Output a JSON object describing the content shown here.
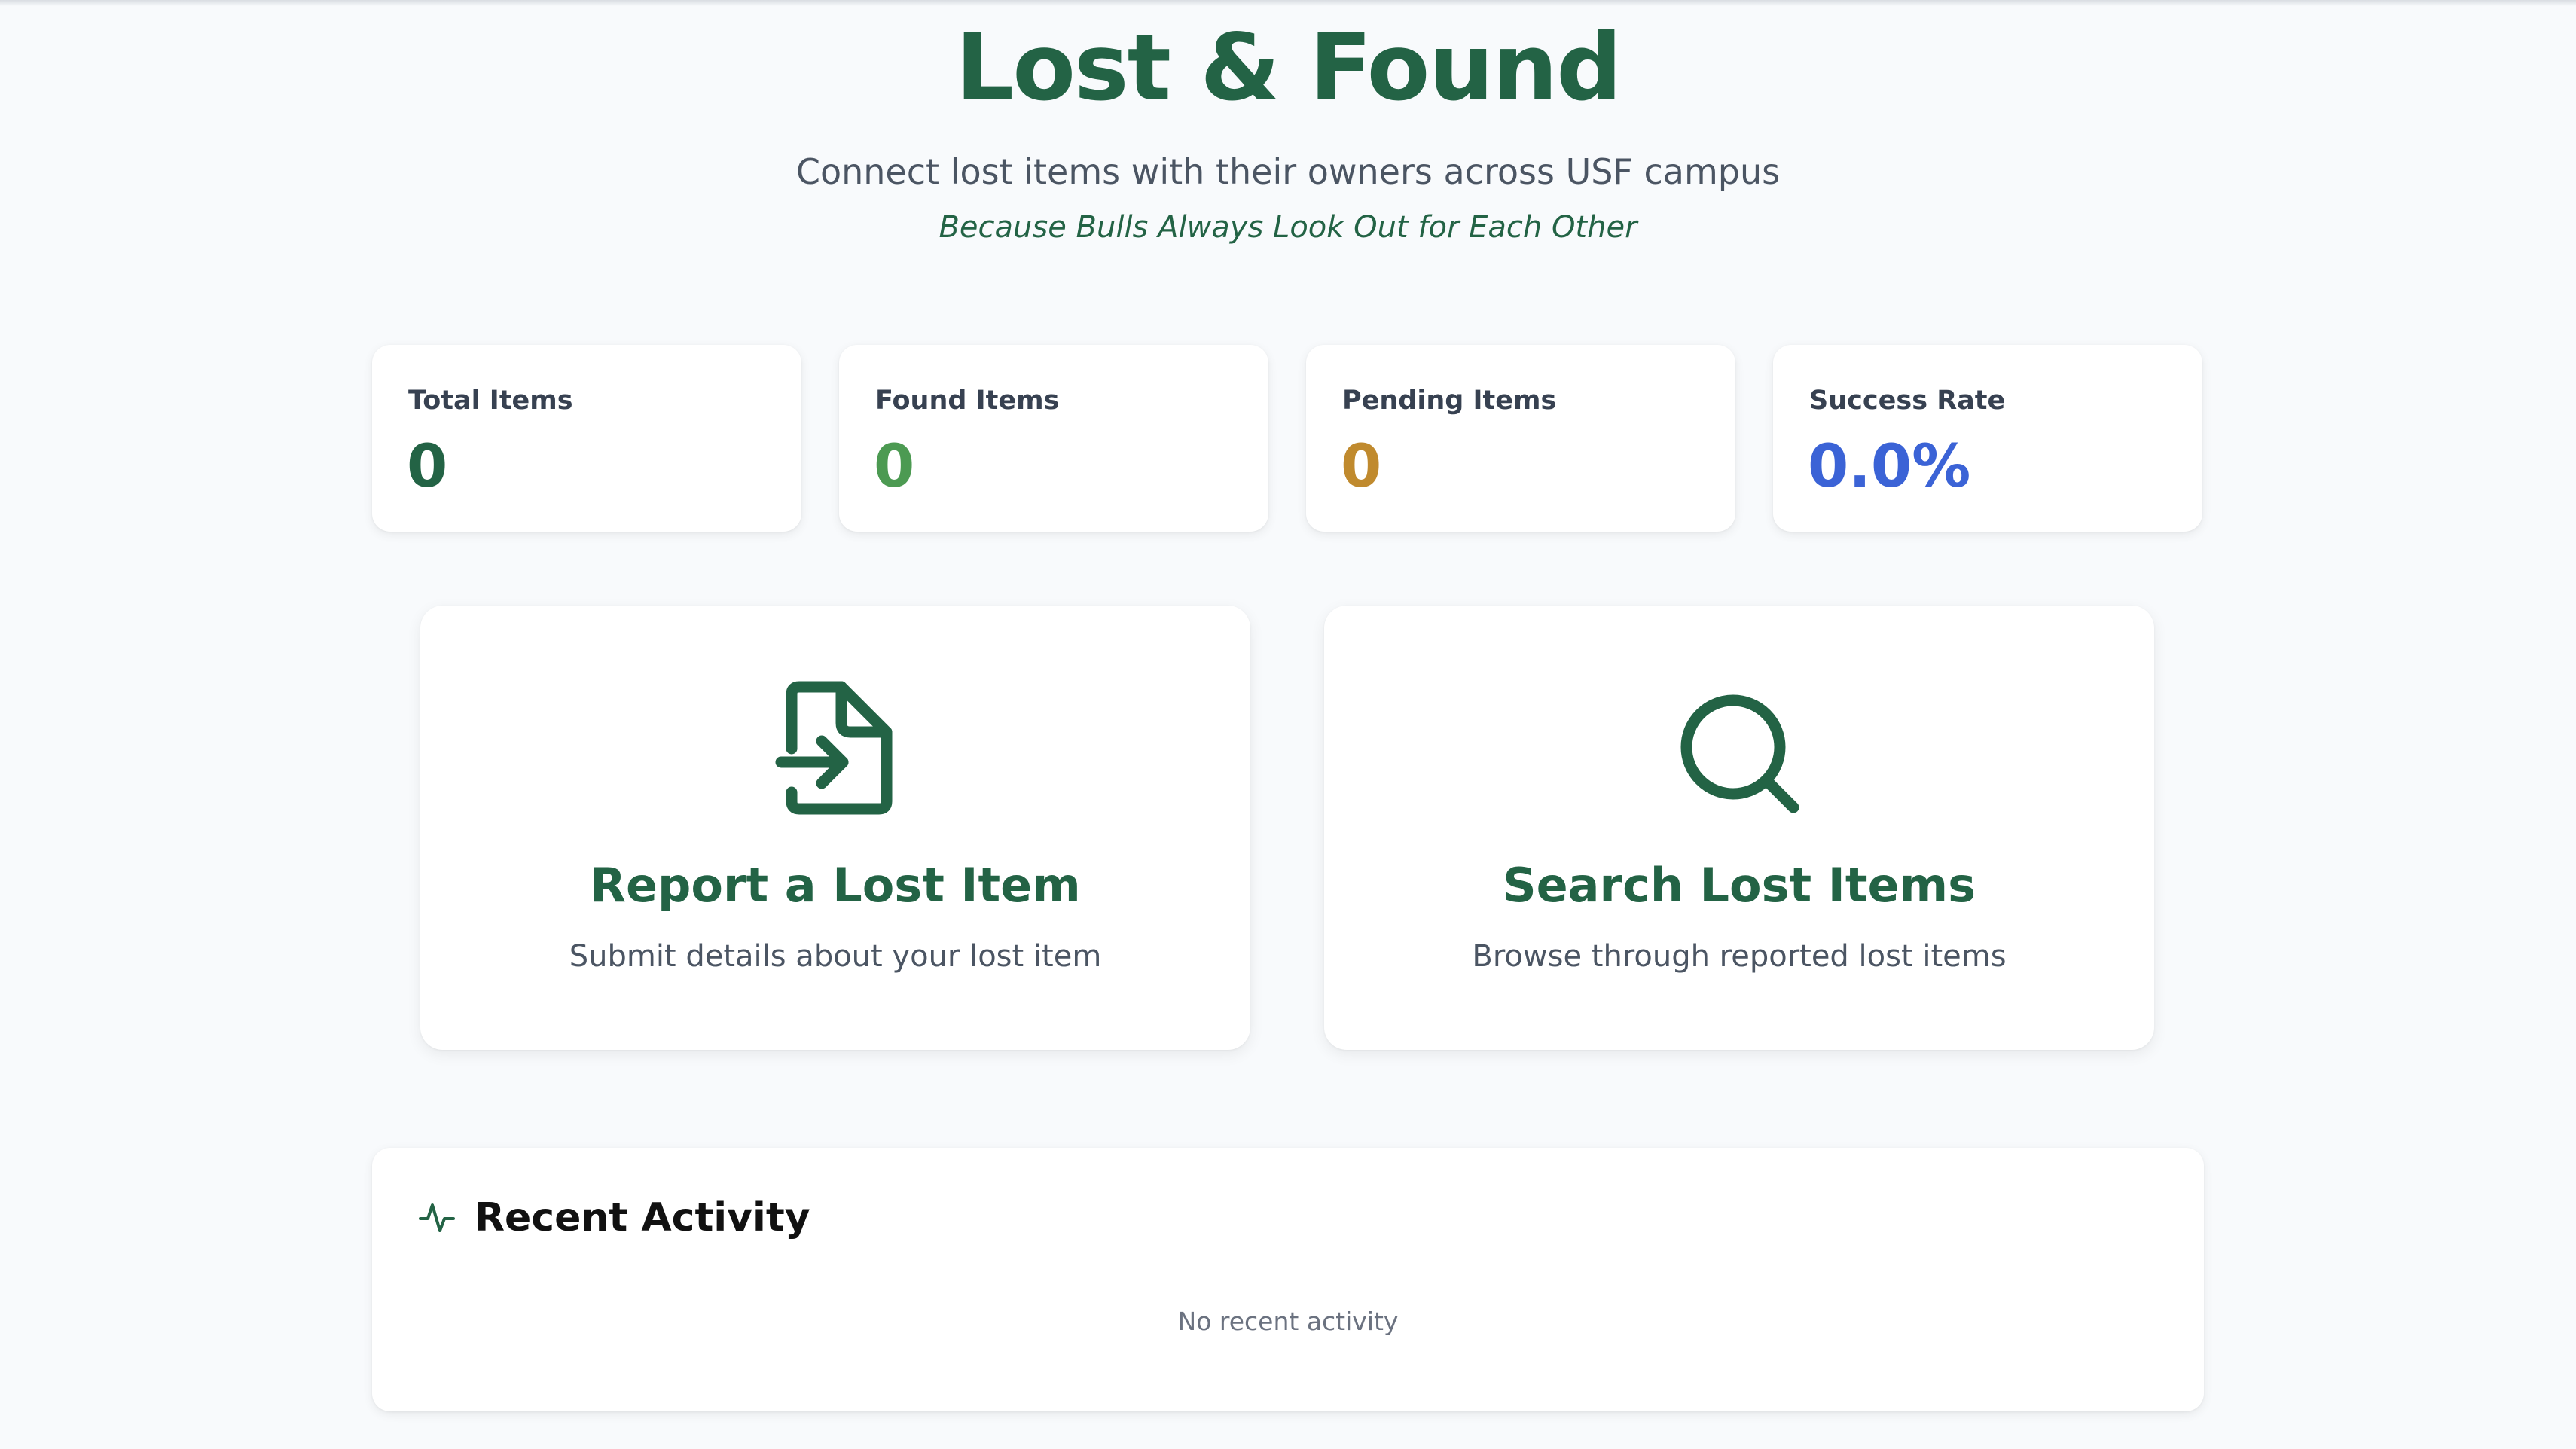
{
  "header": {
    "title": "Lost & Found",
    "subtitle": "Connect lost items with their owners across USF campus",
    "tagline": "Because Bulls Always Look Out for Each Other"
  },
  "stats": [
    {
      "label": "Total Items",
      "value": "0",
      "color": "#236345"
    },
    {
      "label": "Found Items",
      "value": "0",
      "color": "#4c9a52"
    },
    {
      "label": "Pending Items",
      "value": "0",
      "color": "#c08a2e"
    },
    {
      "label": "Success Rate",
      "value": "0.0%",
      "color": "#3b63d6"
    }
  ],
  "actions": [
    {
      "icon": "file-import-icon",
      "title": "Report a Lost Item",
      "description": "Submit details about your lost item"
    },
    {
      "icon": "search-icon",
      "title": "Search Lost Items",
      "description": "Browse through reported lost items"
    }
  ],
  "recent_activity": {
    "icon": "activity-pulse-icon",
    "title": "Recent Activity",
    "empty_text": "No recent activity"
  },
  "colors": {
    "brand_green": "#236345",
    "background": "#f8fafc"
  }
}
